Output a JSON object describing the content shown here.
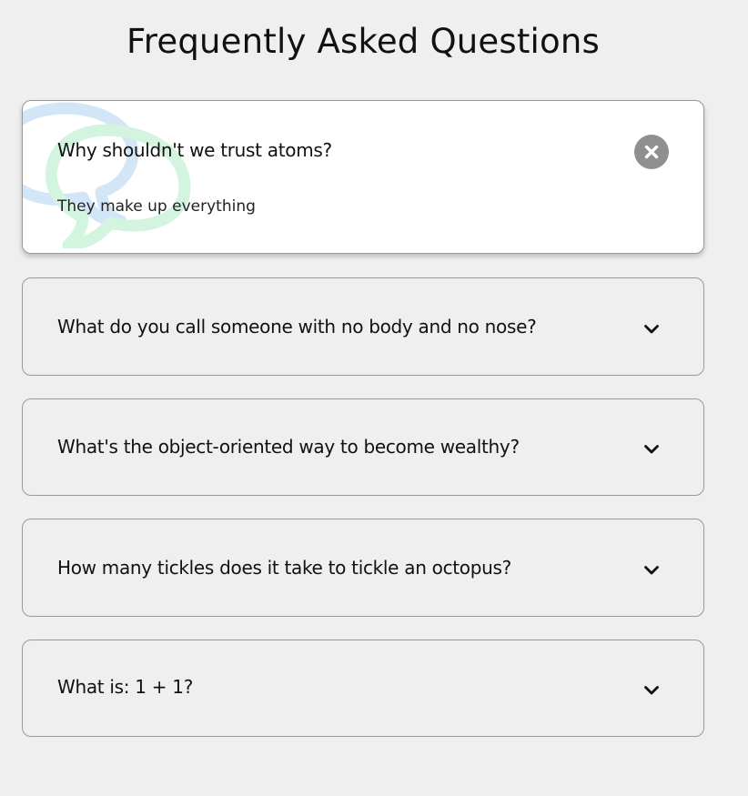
{
  "page": {
    "title": "Frequently Asked Questions"
  },
  "faqs": [
    {
      "question": "Why shouldn't we trust atoms?",
      "answer": "They make up everything",
      "expanded": true,
      "toggle_icon": "close-icon"
    },
    {
      "question": "What do you call someone with no body and no nose?",
      "expanded": false,
      "toggle_icon": "chevron-down-icon"
    },
    {
      "question": "What's the object-oriented way to become wealthy?",
      "expanded": false,
      "toggle_icon": "chevron-down-icon"
    },
    {
      "question": "How many tickles does it take to tickle an octopus?",
      "expanded": false,
      "toggle_icon": "chevron-down-icon"
    },
    {
      "question": "What is: 1 + 1?",
      "expanded": false,
      "toggle_icon": "chevron-down-icon"
    }
  ],
  "colors": {
    "page_background": "#efefef",
    "active_card_background": "#ffffff",
    "card_border": "#9a9a9a",
    "close_button": "#8f8f8f",
    "bubble_blue": "#d3e6f7",
    "bubble_green": "#d3f4df",
    "text": "#111111"
  }
}
